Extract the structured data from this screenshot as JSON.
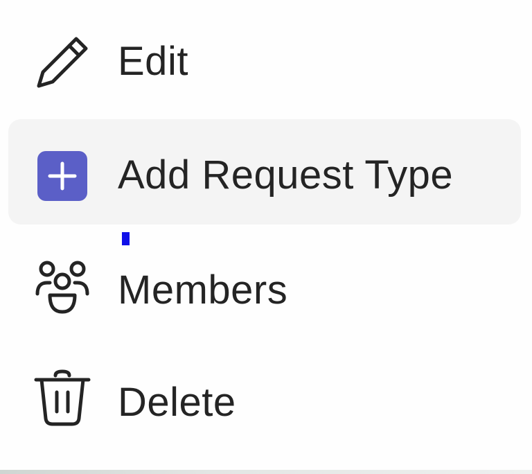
{
  "menu": {
    "items": [
      {
        "label": "Edit",
        "icon": "pencil-icon"
      },
      {
        "label": "Add Request Type",
        "icon": "add-square-icon",
        "accent": "#5b5fc7"
      },
      {
        "label": "Members",
        "icon": "people-group-icon"
      },
      {
        "label": "Delete",
        "icon": "trash-icon"
      }
    ]
  }
}
